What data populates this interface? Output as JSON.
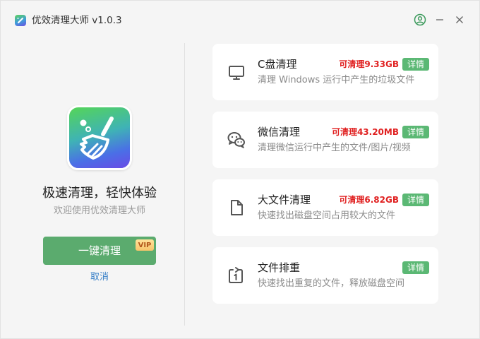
{
  "app": {
    "title": "优效清理大师 v1.0.3"
  },
  "titlebar": {
    "icons": [
      "user-icon",
      "minimize-icon",
      "close-icon"
    ]
  },
  "left": {
    "slogan": "极速清理，轻快体验",
    "subtitle": "欢迎使用优效清理大师",
    "clean_button_label": "一键清理",
    "vip_badge": "VIP",
    "cancel_label": "取消"
  },
  "cards": [
    {
      "icon": "monitor-icon",
      "title": "C盘清理",
      "amount": "可清理9.33GB",
      "description": "清理 Windows 运行中产生的垃圾文件",
      "detail_label": "详情"
    },
    {
      "icon": "wechat-icon",
      "title": "微信清理",
      "amount": "可清理43.20MB",
      "description": "清理微信运行中产生的文件/图片/视频",
      "detail_label": "详情"
    },
    {
      "icon": "file-icon",
      "title": "大文件清理",
      "amount": "可清理6.82GB",
      "description": "快速找出磁盘空间占用较大的文件",
      "detail_label": "详情"
    },
    {
      "icon": "duplicate-icon",
      "title": "文件排重",
      "amount": "",
      "description": "快速找出重复的文件，释放磁盘空间",
      "detail_label": "详情"
    }
  ],
  "colors": {
    "accent_green": "#5bab6e",
    "detail_green": "#5bb874",
    "amount_red": "#e02020",
    "link_blue": "#3b82c8",
    "background": "#f5f5f5"
  }
}
